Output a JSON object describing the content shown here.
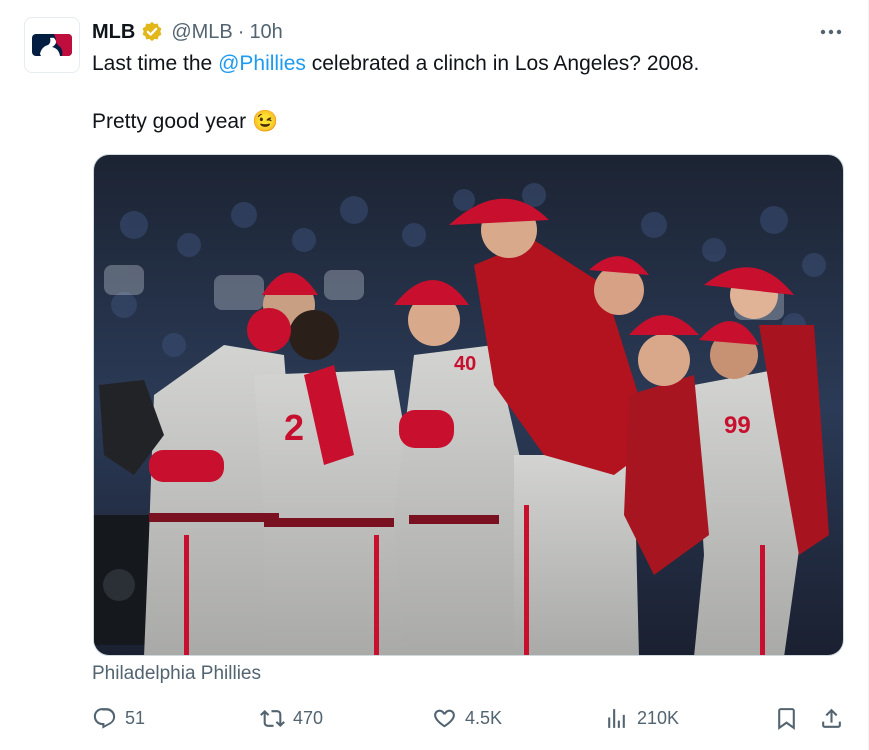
{
  "tweet": {
    "author_name": "MLB",
    "handle": "@MLB",
    "separator": "·",
    "time": "10h",
    "text_before": "Last time the ",
    "mention": "@Phillies",
    "text_after": " celebrated a clinch in Los Angeles? 2008.",
    "second_line": "Pretty good year",
    "emoji": "😉",
    "media_caption": "Philadelphia Phillies"
  },
  "actions": {
    "replies": "51",
    "reposts": "470",
    "likes": "4.5K",
    "views": "210K"
  },
  "icons": {
    "avatar": "mlb-logo-icon",
    "verified": "verified-badge-icon",
    "more": "more-options-icon",
    "reply": "reply-icon",
    "repost": "repost-icon",
    "like": "heart-icon",
    "views": "analytics-icon",
    "bookmark": "bookmark-icon",
    "share": "share-icon"
  },
  "colors": {
    "accent": "#1d9bf0",
    "secondary_text": "#536471",
    "verified_gold": "#e2b719",
    "phillies_red": "#c8102e",
    "mlb_navy": "#041e42"
  }
}
